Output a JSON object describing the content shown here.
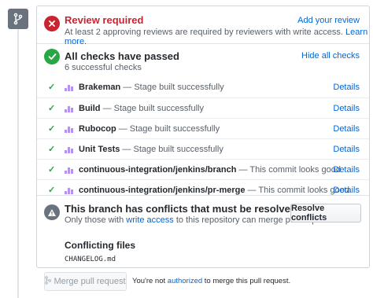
{
  "review": {
    "title": "Review required",
    "subtitle": "At least 2 approving reviews are required by reviewers with write access.",
    "learn_more": "Learn more.",
    "add_reviewer": "Add your review"
  },
  "checks": {
    "title": "All checks have passed",
    "subtitle": "6 successful checks",
    "hide_link": "Hide all checks",
    "items": [
      {
        "name": "Brakeman",
        "desc": "— Stage built successfully",
        "details": "Details"
      },
      {
        "name": "Build",
        "desc": "— Stage built successfully",
        "details": "Details"
      },
      {
        "name": "Rubocop",
        "desc": "— Stage built successfully",
        "details": "Details"
      },
      {
        "name": "Unit Tests",
        "desc": "— Stage built successfully",
        "details": "Details"
      },
      {
        "name": "continuous-integration/jenkins/branch",
        "desc": "— This commit looks good",
        "details": "Details"
      },
      {
        "name": "continuous-integration/jenkins/pr-merge",
        "desc": "— This commit looks good",
        "details": "Details"
      }
    ]
  },
  "conflicts": {
    "title": "This branch has conflicts that must be resolved",
    "subtitle_pre": "Only those with",
    "subtitle_link": "write access",
    "subtitle_post": "to this repository can merge pull requests.",
    "resolve_button": "Resolve conflicts",
    "files_title": "Conflicting files",
    "files": [
      "CHANGELOG.md"
    ]
  },
  "merge": {
    "button": "Merge pull request",
    "note_pre": "You're not",
    "note_link": "authorized",
    "note_post": "to merge this pull request."
  },
  "colors": {
    "error": "#cb2431",
    "success": "#28a745",
    "link": "#0366d6",
    "neutral": "#6a737d"
  },
  "icons": {
    "branch": "git-branch-icon",
    "error": "x-circle-icon",
    "success": "check-circle-icon",
    "check": "check-icon",
    "ci_logo": "ci-logo-icon",
    "warning": "alert-icon",
    "merge": "git-merge-icon"
  }
}
